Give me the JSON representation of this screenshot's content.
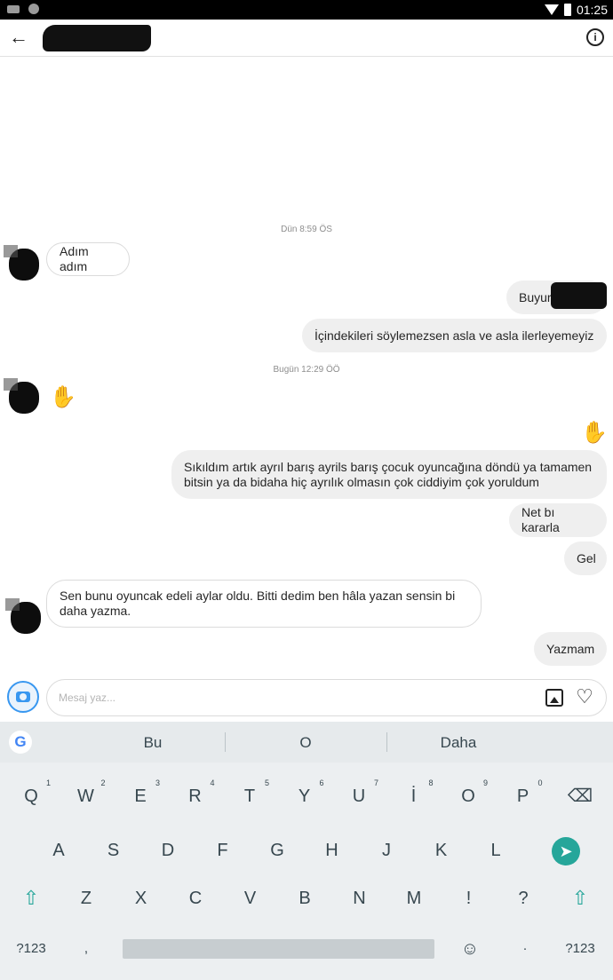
{
  "status_bar": {
    "time": "01:25"
  },
  "header": {
    "back_icon": "arrow-left-icon",
    "info_icon": "info-icon"
  },
  "thread": {
    "timestamp_1": "Dün 8:59 ÖS",
    "timestamp_2": "Bugün 12:29 ÖÖ",
    "messages": [
      {
        "side": "in",
        "text": "Adım adım"
      },
      {
        "side": "out",
        "text": "Buyur"
      },
      {
        "side": "out",
        "text": "İçindekileri söylemezsen asla ve asla ilerleyemeyiz"
      },
      {
        "side": "in",
        "text": ""
      },
      {
        "side": "out",
        "text": ""
      },
      {
        "side": "out",
        "text": "Sıkıldım artık ayrıl barış ayrils barış çocuk oyuncağına döndü ya tamamen bitsin ya da bidaha hiç ayrılık olmasın çok ciddiyim çok yoruldum"
      },
      {
        "side": "out",
        "text": "Net bı kararla"
      },
      {
        "side": "out",
        "text": "Gel"
      },
      {
        "side": "in",
        "text": "Sen bunu oyuncak edeli aylar oldu. Bitti dedim ben hâla yazan sensin bi daha yazma."
      },
      {
        "side": "out",
        "text": "Yazmam"
      }
    ],
    "heart_color": "#e0588a"
  },
  "composer": {
    "placeholder": "Mesaj yaz...",
    "accent": "#3897f0"
  },
  "suggestions": [
    "Bu",
    "O",
    "Daha"
  ],
  "keyboard": {
    "row1": [
      "Q",
      "W",
      "E",
      "R",
      "T",
      "Y",
      "U",
      "İ",
      "O",
      "P"
    ],
    "row1_hints": [
      "1",
      "2",
      "3",
      "4",
      "5",
      "6",
      "7",
      "8",
      "9",
      "0"
    ],
    "row2": [
      "A",
      "S",
      "D",
      "F",
      "G",
      "H",
      "J",
      "K",
      "L"
    ],
    "row3": [
      "Z",
      "X",
      "C",
      "V",
      "B",
      "N",
      "M",
      "!",
      "?"
    ],
    "symbols_label": "?123",
    "comma": ",",
    "period": "·",
    "accent": "#26a69a"
  }
}
